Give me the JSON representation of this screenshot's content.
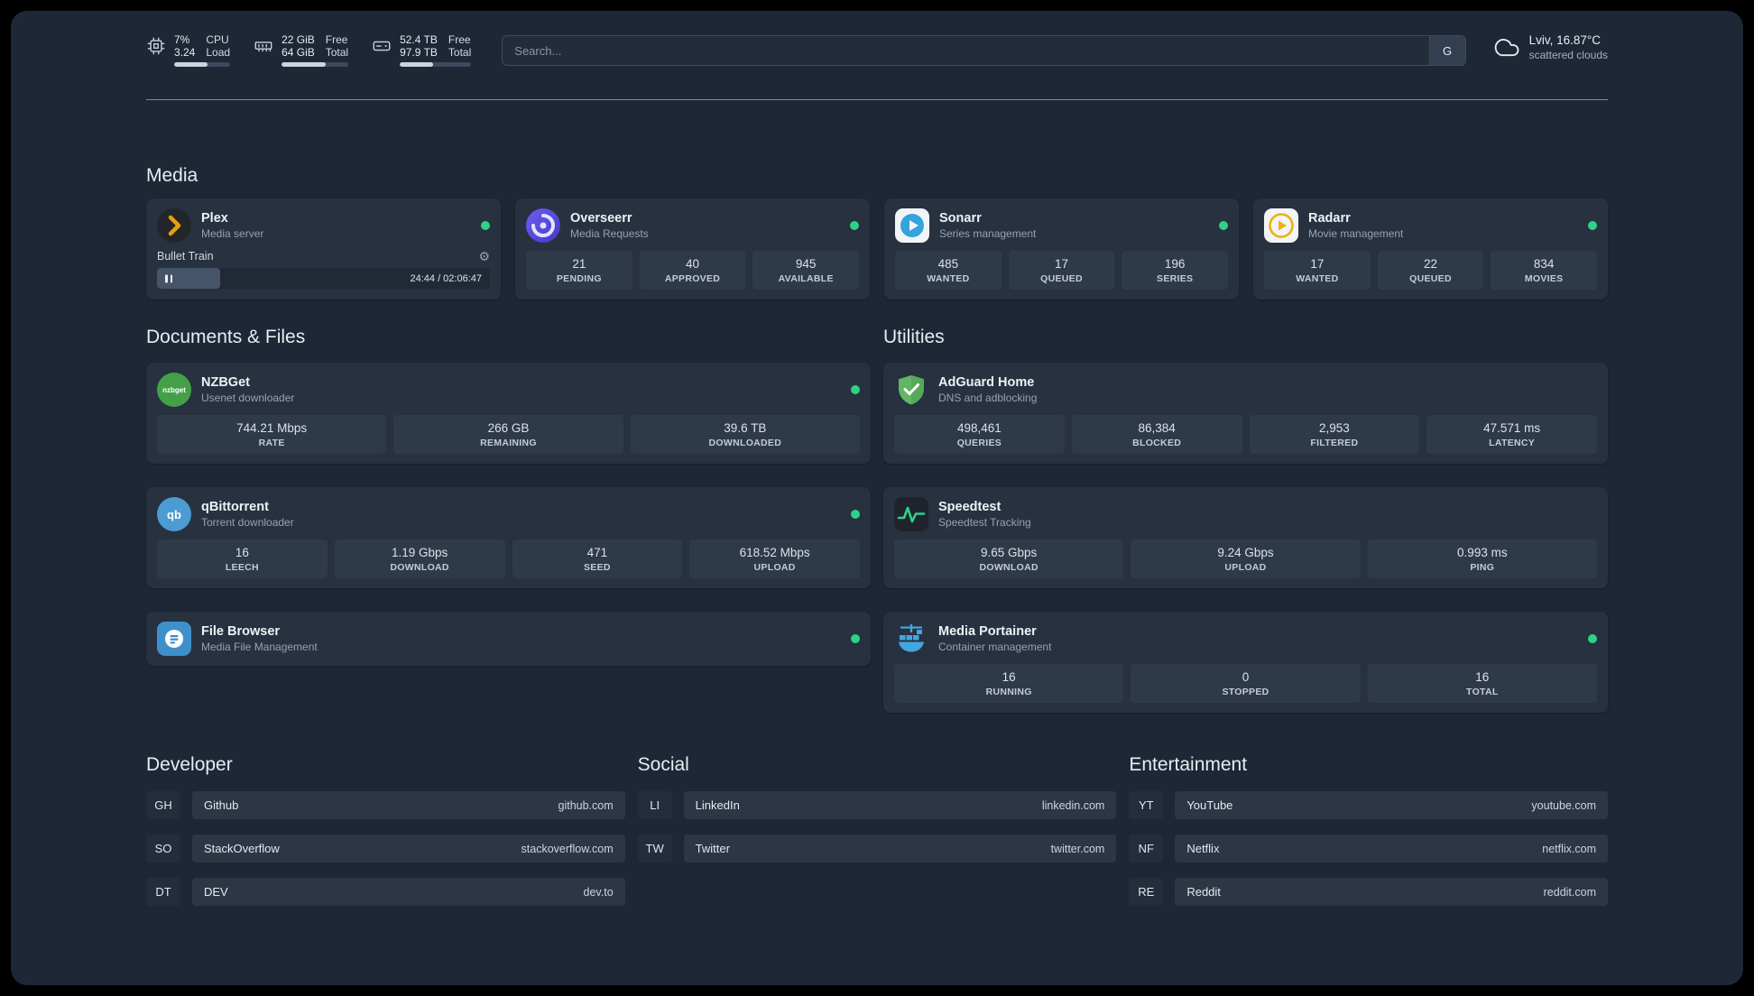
{
  "colors": {
    "status_green": "#2fd184",
    "plex_accent": "#e5a00d"
  },
  "topbar": {
    "resources": [
      {
        "icon": "cpu-icon",
        "col1": [
          "7%",
          "3.24"
        ],
        "col2": [
          "CPU",
          "Load"
        ],
        "progress_pct": 60
      },
      {
        "icon": "memory-icon",
        "col1": [
          "22 GiB",
          "64 GiB"
        ],
        "col2": [
          "Free",
          "Total"
        ],
        "progress_pct": 66
      },
      {
        "icon": "disk-icon",
        "col1": [
          "52.4 TB",
          "97.9 TB"
        ],
        "col2": [
          "Free",
          "Total"
        ],
        "progress_pct": 47
      }
    ],
    "search": {
      "placeholder": "Search...",
      "button_label": "G"
    },
    "weather": {
      "location": "Lviv, 16.87°C",
      "condition": "scattered clouds"
    }
  },
  "media": {
    "heading": "Media",
    "plex": {
      "name": "Plex",
      "subtitle": "Media server",
      "now_playing": "Bullet Train",
      "time": "24:44 / 02:06:47",
      "progress_pct": 19
    },
    "overseerr": {
      "name": "Overseerr",
      "subtitle": "Media Requests",
      "stats": [
        {
          "value": "21",
          "label": "PENDING"
        },
        {
          "value": "40",
          "label": "APPROVED"
        },
        {
          "value": "945",
          "label": "AVAILABLE"
        }
      ]
    },
    "sonarr": {
      "name": "Sonarr",
      "subtitle": "Series management",
      "stats": [
        {
          "value": "485",
          "label": "WANTED"
        },
        {
          "value": "17",
          "label": "QUEUED"
        },
        {
          "value": "196",
          "label": "SERIES"
        }
      ]
    },
    "radarr": {
      "name": "Radarr",
      "subtitle": "Movie management",
      "stats": [
        {
          "value": "17",
          "label": "WANTED"
        },
        {
          "value": "22",
          "label": "QUEUED"
        },
        {
          "value": "834",
          "label": "MOVIES"
        }
      ]
    }
  },
  "documents": {
    "heading": "Documents & Files",
    "nzbget": {
      "name": "NZBGet",
      "subtitle": "Usenet downloader",
      "icon_label": "nzbget",
      "stats": [
        {
          "value": "744.21 Mbps",
          "label": "RATE"
        },
        {
          "value": "266 GB",
          "label": "REMAINING"
        },
        {
          "value": "39.6 TB",
          "label": "DOWNLOADED"
        }
      ]
    },
    "qbittorrent": {
      "name": "qBittorrent",
      "subtitle": "Torrent downloader",
      "icon_label": "qb",
      "stats": [
        {
          "value": "16",
          "label": "LEECH"
        },
        {
          "value": "1.19 Gbps",
          "label": "DOWNLOAD"
        },
        {
          "value": "471",
          "label": "SEED"
        },
        {
          "value": "618.52 Mbps",
          "label": "UPLOAD"
        }
      ]
    },
    "filebrowser": {
      "name": "File Browser",
      "subtitle": "Media File Management"
    }
  },
  "utilities": {
    "heading": "Utilities",
    "adguard": {
      "name": "AdGuard Home",
      "subtitle": "DNS and adblocking",
      "stats": [
        {
          "value": "498,461",
          "label": "QUERIES"
        },
        {
          "value": "86,384",
          "label": "BLOCKED"
        },
        {
          "value": "2,953",
          "label": "FILTERED"
        },
        {
          "value": "47.571 ms",
          "label": "LATENCY"
        }
      ]
    },
    "speedtest": {
      "name": "Speedtest",
      "subtitle": "Speedtest Tracking",
      "stats": [
        {
          "value": "9.65 Gbps",
          "label": "DOWNLOAD"
        },
        {
          "value": "9.24 Gbps",
          "label": "UPLOAD"
        },
        {
          "value": "0.993 ms",
          "label": "PING"
        }
      ]
    },
    "portainer": {
      "name": "Media Portainer",
      "subtitle": "Container management",
      "stats": [
        {
          "value": "16",
          "label": "RUNNING"
        },
        {
          "value": "0",
          "label": "STOPPED"
        },
        {
          "value": "16",
          "label": "TOTAL"
        }
      ]
    }
  },
  "bookmarks": {
    "developer": {
      "heading": "Developer",
      "items": [
        {
          "abbr": "GH",
          "name": "Github",
          "url": "github.com"
        },
        {
          "abbr": "SO",
          "name": "StackOverflow",
          "url": "stackoverflow.com"
        },
        {
          "abbr": "DT",
          "name": "DEV",
          "url": "dev.to"
        }
      ]
    },
    "social": {
      "heading": "Social",
      "items": [
        {
          "abbr": "LI",
          "name": "LinkedIn",
          "url": "linkedin.com"
        },
        {
          "abbr": "TW",
          "name": "Twitter",
          "url": "twitter.com"
        }
      ]
    },
    "entertainment": {
      "heading": "Entertainment",
      "items": [
        {
          "abbr": "YT",
          "name": "YouTube",
          "url": "youtube.com"
        },
        {
          "abbr": "NF",
          "name": "Netflix",
          "url": "netflix.com"
        },
        {
          "abbr": "RE",
          "name": "Reddit",
          "url": "reddit.com"
        }
      ]
    }
  }
}
